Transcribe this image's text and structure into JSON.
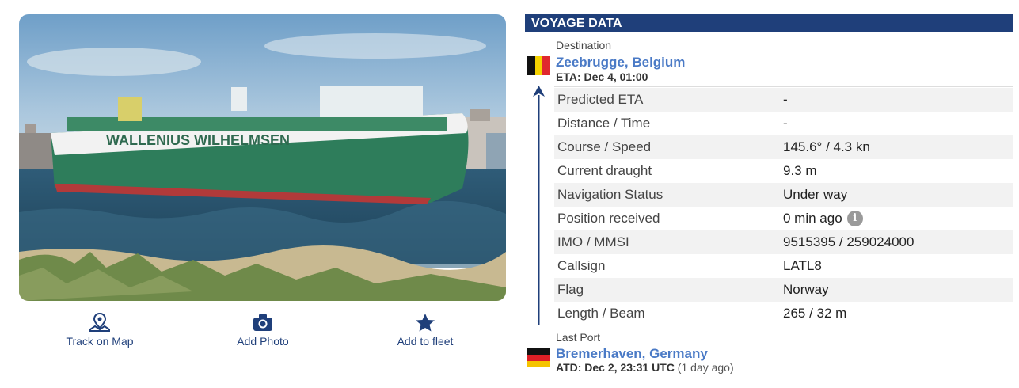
{
  "actions": [
    {
      "label": "Track on Map",
      "icon": "map-pin-icon"
    },
    {
      "label": "Add Photo",
      "icon": "camera-icon"
    },
    {
      "label": "Add to fleet",
      "icon": "star-icon"
    }
  ],
  "ship_hull_text": "WALLENIUS WILHELMSEN",
  "voyage": {
    "title": "VOYAGE DATA",
    "destination": {
      "label": "Destination",
      "port": "Zeebrugge, Belgium",
      "eta": "ETA: Dec 4, 01:00",
      "flag": "belgium-flag"
    },
    "rows": [
      {
        "key": "Predicted ETA",
        "value": "-"
      },
      {
        "key": "Distance / Time",
        "value": "-"
      },
      {
        "key": "Course / Speed",
        "value": "145.6° / 4.3 kn"
      },
      {
        "key": "Current draught",
        "value": "9.3 m"
      },
      {
        "key": "Navigation Status",
        "value": "Under way"
      },
      {
        "key": "Position received",
        "value": "0 min ago",
        "info": "i"
      },
      {
        "key": "IMO / MMSI",
        "value": "9515395 / 259024000"
      },
      {
        "key": "Callsign",
        "value": "LATL8"
      },
      {
        "key": "Flag",
        "value": "Norway"
      },
      {
        "key": "Length / Beam",
        "value": "265 / 32 m"
      }
    ],
    "last_port": {
      "label": "Last Port",
      "port": "Bremerhaven, Germany",
      "atd": "ATD: Dec 2, 23:31 UTC",
      "atd_relative": "(1 day ago)",
      "flag": "germany-flag"
    }
  },
  "colors": {
    "header_bg": "#1f3f7a",
    "link": "#4a7ac6",
    "hull_green": "#2e7d5b"
  }
}
